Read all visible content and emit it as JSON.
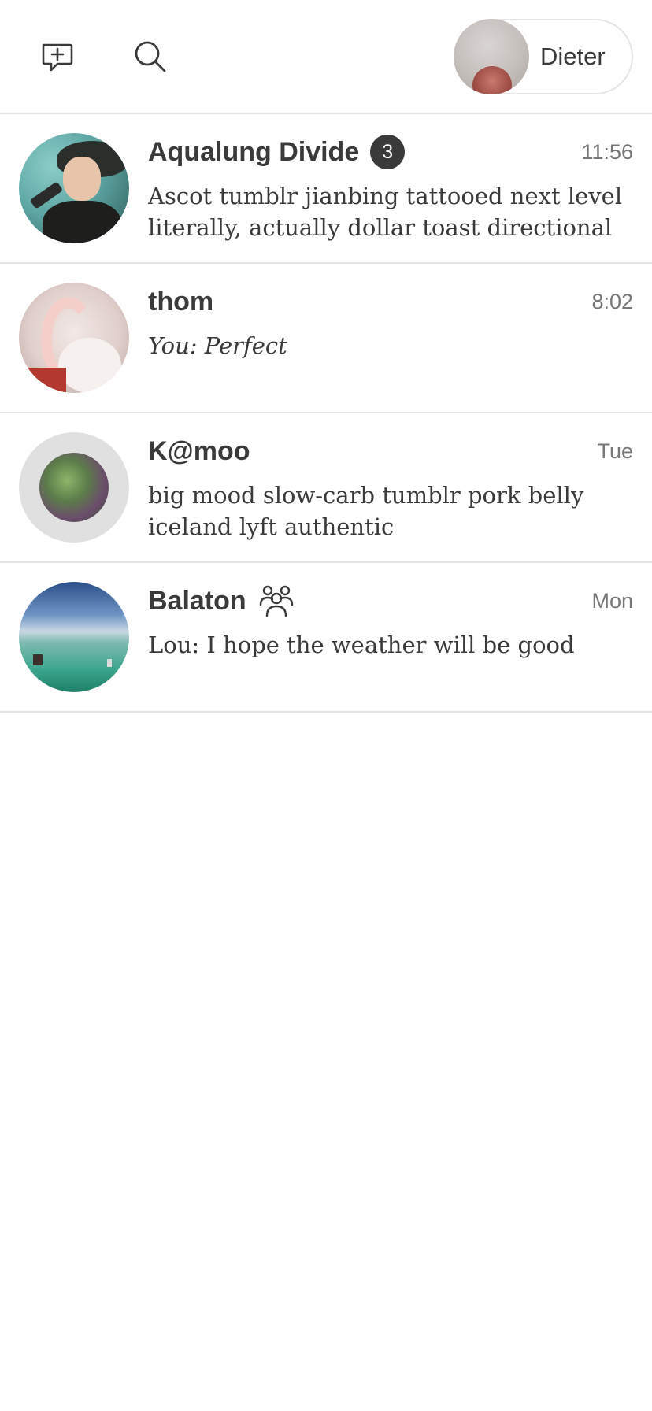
{
  "header": {
    "new_chat_icon": "new-message-icon",
    "search_icon": "search-icon",
    "profile": {
      "name": "Dieter"
    }
  },
  "conversations": [
    {
      "title": "Aqualung Divide",
      "badge": "3",
      "time": "11:56",
      "preview": "Ascot tumblr jianbing tattooed next level literally, actually dollar toast directional",
      "italic": false,
      "group": false
    },
    {
      "title": "thom",
      "badge": null,
      "time": "8:02",
      "preview": "You: Perfect",
      "italic": true,
      "group": false
    },
    {
      "title": "K@moo",
      "badge": null,
      "time": "Tue",
      "preview": "big mood slow-carb tumblr pork belly iceland lyft authentic",
      "italic": false,
      "group": false
    },
    {
      "title": "Balaton",
      "badge": null,
      "time": "Mon",
      "preview": "Lou: I hope the weather will be good",
      "italic": false,
      "group": true,
      "group_icon": "group-icon"
    }
  ],
  "colors": {
    "text": "#3a3a3a",
    "muted": "#777777",
    "divider": "#e4e4e4",
    "badge_bg": "#3a3a3a"
  }
}
